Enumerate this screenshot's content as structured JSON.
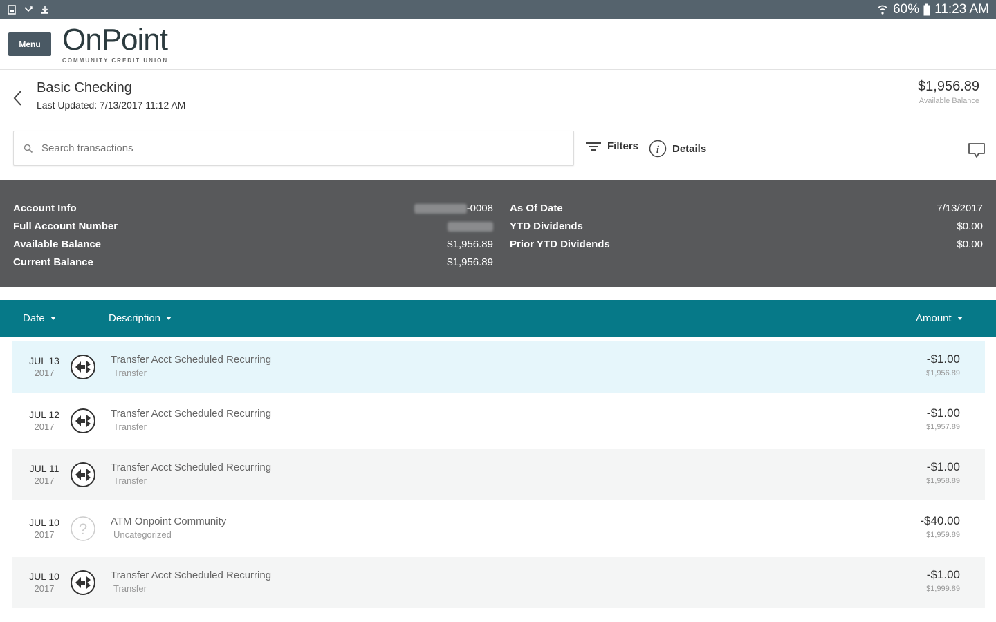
{
  "status_bar": {
    "battery": "60%",
    "time": "11:23 AM"
  },
  "header": {
    "menu_label": "Menu",
    "logo_text": "OnPoint",
    "logo_subtext": "COMMUNITY CREDIT UNION"
  },
  "account": {
    "name": "Basic Checking",
    "last_updated": "Last Updated: 7/13/2017 11:12 AM",
    "available_balance": "$1,956.89",
    "available_balance_label": "Available Balance"
  },
  "search": {
    "placeholder": "Search transactions"
  },
  "toolbar": {
    "filters_label": "Filters",
    "details_label": "Details"
  },
  "account_info": {
    "left": [
      {
        "label": "Account Info",
        "value": "-0008"
      },
      {
        "label": "Full Account Number",
        "value": ""
      },
      {
        "label": "Available Balance",
        "value": "$1,956.89"
      },
      {
        "label": "Current Balance",
        "value": "$1,956.89"
      }
    ],
    "right": [
      {
        "label": "As Of Date",
        "value": "7/13/2017"
      },
      {
        "label": "YTD Dividends",
        "value": "$0.00"
      },
      {
        "label": "Prior YTD Dividends",
        "value": "$0.00"
      }
    ]
  },
  "table": {
    "headers": {
      "date": "Date",
      "description": "Description",
      "amount": "Amount"
    }
  },
  "transactions": [
    {
      "date": "JUL 13",
      "year": "2017",
      "icon": "transfer-icon",
      "description": "Transfer Acct Scheduled Recurring",
      "category": "Transfer",
      "amount": "-$1.00",
      "running_balance": "$1,956.89"
    },
    {
      "date": "JUL 12",
      "year": "2017",
      "icon": "transfer-icon",
      "description": "Transfer Acct Scheduled Recurring",
      "category": "Transfer",
      "amount": "-$1.00",
      "running_balance": "$1,957.89"
    },
    {
      "date": "JUL 11",
      "year": "2017",
      "icon": "transfer-icon",
      "description": "Transfer Acct Scheduled Recurring",
      "category": "Transfer",
      "amount": "-$1.00",
      "running_balance": "$1,958.89"
    },
    {
      "date": "JUL 10",
      "year": "2017",
      "icon": "question-icon",
      "description": "ATM Onpoint Community",
      "category": "Uncategorized",
      "amount": "-$40.00",
      "running_balance": "$1,959.89"
    },
    {
      "date": "JUL 10",
      "year": "2017",
      "icon": "transfer-icon",
      "description": "Transfer Acct Scheduled Recurring",
      "category": "Transfer",
      "amount": "-$1.00",
      "running_balance": "$1,999.89"
    }
  ],
  "colors": {
    "status_bar": "#55636d",
    "table_header": "#067988",
    "info_panel": "#58595b",
    "selected_row": "#e6f6fb"
  }
}
